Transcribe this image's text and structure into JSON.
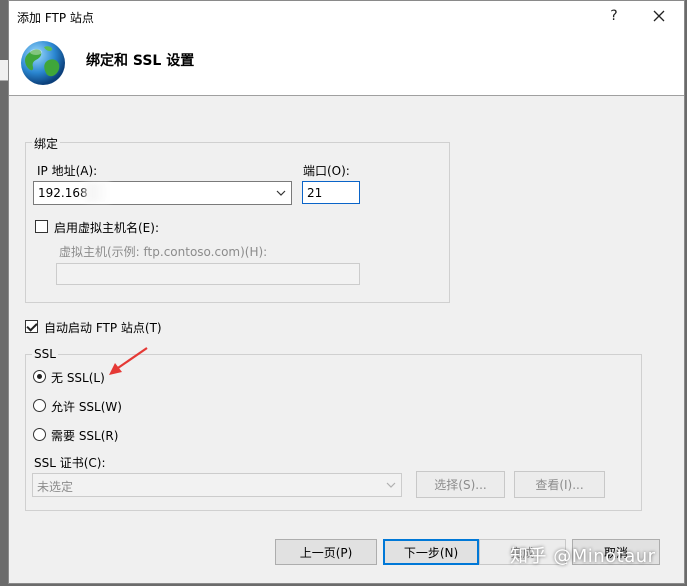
{
  "window": {
    "title": "添加 FTP 站点",
    "help_label": "?",
    "close_label": "✕"
  },
  "header": {
    "title": "绑定和 SSL 设置",
    "icon": "globe-icon"
  },
  "binding": {
    "legend": "绑定",
    "ip_label": "IP 地址(A):",
    "ip_value": "192.168",
    "port_label": "端口(O):",
    "port_value": "21",
    "virtual_host_checkbox_label": "启用虚拟主机名(E):",
    "virtual_host_checked": false,
    "virtual_host_label": "虚拟主机(示例: ftp.contoso.com)(H):",
    "virtual_host_value": ""
  },
  "autostart": {
    "label": "自动启动 FTP 站点(T)",
    "checked": true
  },
  "ssl": {
    "legend": "SSL",
    "options": [
      {
        "label": "无 SSL(L)",
        "checked": true
      },
      {
        "label": "允许 SSL(W)",
        "checked": false
      },
      {
        "label": "需要 SSL(R)",
        "checked": false
      }
    ],
    "cert_label": "SSL 证书(C):",
    "cert_value": "未选定",
    "select_button": "选择(S)...",
    "view_button": "查看(I)..."
  },
  "footer": {
    "prev_button": "上一页(P)",
    "next_button": "下一步(N)",
    "finish_button": "完成",
    "cancel_button": "取消"
  },
  "watermark": "知乎 @Minotaur",
  "colors": {
    "focus_border": "#0a64c8",
    "annotation_arrow": "#e53935"
  }
}
